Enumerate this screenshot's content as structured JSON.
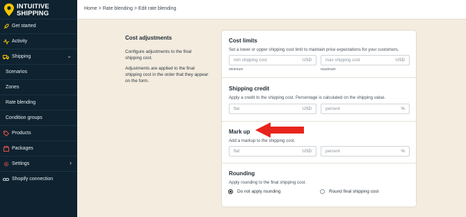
{
  "brand": {
    "line1": "INTUITIVE",
    "line2": "SHIPPING",
    "accent": "#f5c400"
  },
  "sidebar": {
    "items": [
      {
        "label": "Get started",
        "icon": "rocket-icon"
      },
      {
        "label": "Activity",
        "icon": "activity-icon"
      },
      {
        "label": "Shipping",
        "icon": "truck-icon"
      },
      {
        "label": "Scenarios"
      },
      {
        "label": "Zones"
      },
      {
        "label": "Rate blending"
      },
      {
        "label": "Condition groups"
      },
      {
        "label": "Products",
        "icon": "tag-icon"
      },
      {
        "label": "Packages",
        "icon": "package-icon"
      },
      {
        "label": "Settings",
        "icon": "gear-icon"
      },
      {
        "label": "Shopify connection",
        "icon": "link-icon"
      }
    ]
  },
  "breadcrumb": {
    "home": "Home",
    "rate_blending": "Rate blending",
    "current": "Edit rate blending",
    "sep": ">"
  },
  "description": {
    "title": "Cost adjustments",
    "p1": "Configure adjustments to the final shipping cost.",
    "p2": "Adjustments are applied to the final shipping cost in the order that they appear on the form."
  },
  "cost_limits": {
    "title": "Cost limits",
    "helper": "Set a lower or upper shipping cost limit to maintain price expectations for your customers.",
    "min_placeholder": "min shipping cost",
    "max_placeholder": "max shipping cost",
    "currency": "USD",
    "min_caption": "minimum",
    "max_caption": "maximum"
  },
  "shipping_credit": {
    "title": "Shipping credit",
    "helper": "Apply a credit to the shipping cost. Percentage is calculated on the shipping value.",
    "flat_placeholder": "flat",
    "percent_placeholder": "percent",
    "currency": "USD",
    "percent_suffix": "%"
  },
  "mark_up": {
    "title": "Mark up",
    "helper": "Add a markup to the shipping cost.",
    "flat_placeholder": "flat",
    "percent_placeholder": "percent",
    "currency": "USD",
    "percent_suffix": "%"
  },
  "rounding": {
    "title": "Rounding",
    "helper": "Apply rounding to the final shipping cost.",
    "option_none": "Do not apply rounding",
    "option_round": "Round final shipping cost",
    "selected": "none"
  },
  "colors": {
    "sidebar_bg": "#0e2230",
    "page_bg": "#f3ecdf",
    "arrow": "#e8241c"
  }
}
